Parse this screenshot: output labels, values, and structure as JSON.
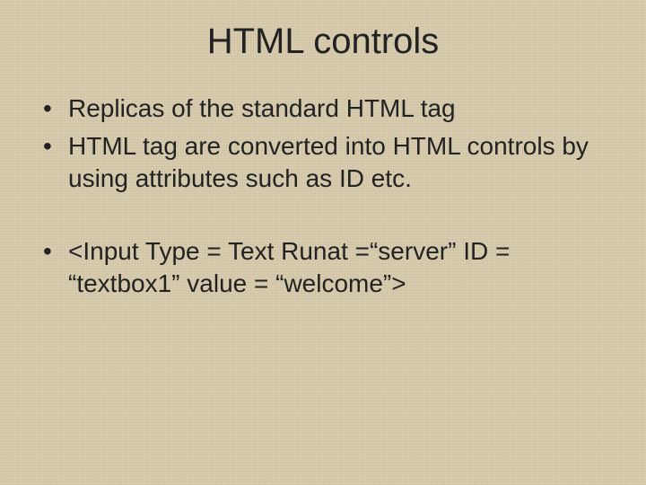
{
  "title": "HTML controls",
  "bullets_group1": [
    "Replicas of the standard HTML tag",
    "HTML tag are converted into HTML controls by using attributes such as ID etc."
  ],
  "bullets_group2": [
    "<Input Type = Text Runat =“server” ID = “textbox1” value = “welcome”>"
  ]
}
